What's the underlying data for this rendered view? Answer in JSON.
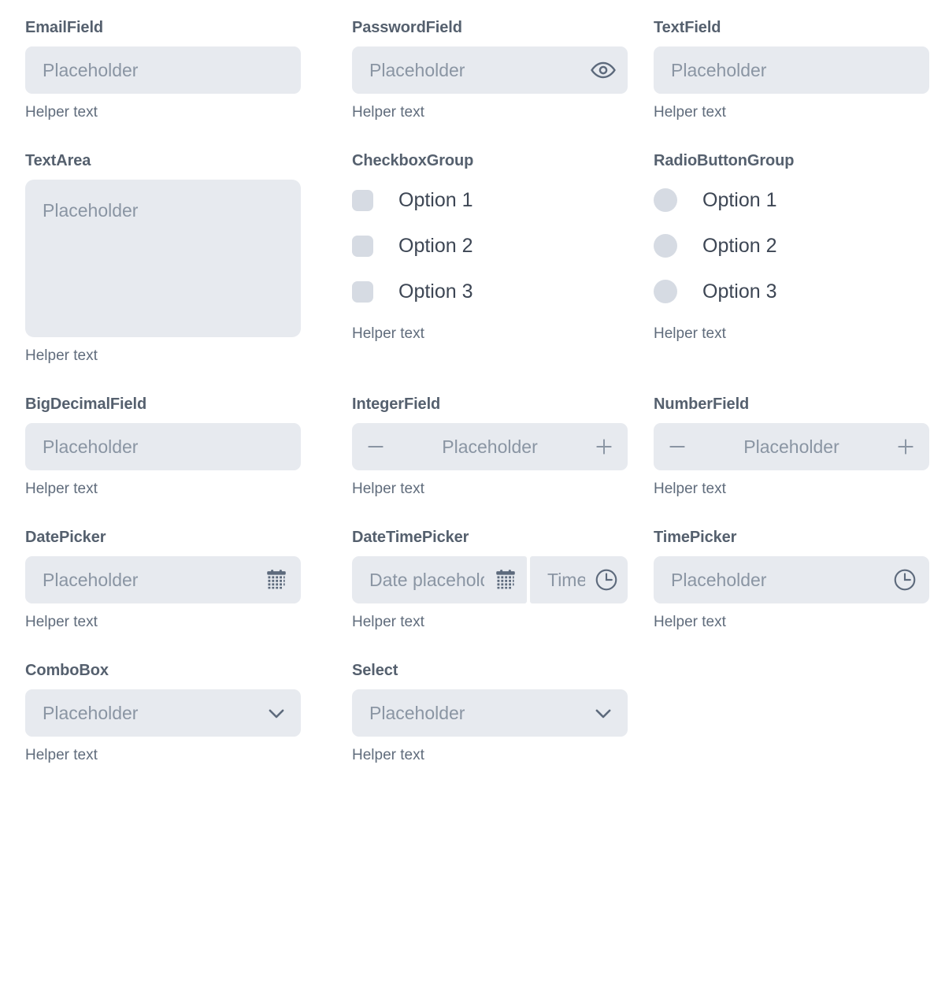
{
  "common": {
    "placeholder": "Placeholder",
    "helper_text": "Helper text",
    "date_placeholder": "Date placeholder",
    "time_placeholder": "Time placeholder"
  },
  "colors": {
    "page_background": "#ffffff",
    "field_background": "#e7eaef",
    "label_text": "#55606e",
    "placeholder_text": "#8a95a3",
    "helper_text": "#606c7c",
    "option_box": "#d6dbe3",
    "option_label": "#3d4654",
    "icon": "#5d6a7c"
  },
  "components": {
    "email_field": {
      "label": "EmailField",
      "placeholder": "Placeholder",
      "helper": "Helper text"
    },
    "password_field": {
      "label": "PasswordField",
      "placeholder": "Placeholder",
      "helper": "Helper text",
      "icon": "eye-icon"
    },
    "text_field": {
      "label": "TextField",
      "placeholder": "Placeholder",
      "helper": "Helper text"
    },
    "text_area": {
      "label": "TextArea",
      "placeholder": "Placeholder",
      "helper": "Helper text"
    },
    "checkbox_group": {
      "label": "CheckboxGroup",
      "helper": "Helper text",
      "options": [
        {
          "label": "Option 1",
          "checked": false
        },
        {
          "label": "Option 2",
          "checked": false
        },
        {
          "label": "Option 3",
          "checked": false
        }
      ]
    },
    "radio_button_group": {
      "label": "RadioButtonGroup",
      "helper": "Helper text",
      "options": [
        {
          "label": "Option 1",
          "selected": false
        },
        {
          "label": "Option 2",
          "selected": false
        },
        {
          "label": "Option 3",
          "selected": false
        }
      ]
    },
    "big_decimal_field": {
      "label": "BigDecimalField",
      "placeholder": "Placeholder",
      "helper": "Helper text"
    },
    "integer_field": {
      "label": "IntegerField",
      "placeholder": "Placeholder",
      "helper": "Helper text",
      "decrement_icon": "minus-icon",
      "increment_icon": "plus-icon"
    },
    "number_field": {
      "label": "NumberField",
      "placeholder": "Placeholder",
      "helper": "Helper text",
      "decrement_icon": "minus-icon",
      "increment_icon": "plus-icon"
    },
    "date_picker": {
      "label": "DatePicker",
      "placeholder": "Placeholder",
      "helper": "Helper text",
      "icon": "calendar-icon"
    },
    "date_time_picker": {
      "label": "DateTimePicker",
      "date_placeholder": "Date placeholder",
      "time_placeholder": "Time placeholder",
      "helper": "Helper text",
      "date_icon": "calendar-icon",
      "time_icon": "clock-icon"
    },
    "time_picker": {
      "label": "TimePicker",
      "placeholder": "Placeholder",
      "helper": "Helper text",
      "icon": "clock-icon"
    },
    "combo_box": {
      "label": "ComboBox",
      "placeholder": "Placeholder",
      "helper": "Helper text",
      "icon": "chevron-down-icon"
    },
    "select": {
      "label": "Select",
      "placeholder": "Placeholder",
      "helper": "Helper text",
      "icon": "chevron-down-icon"
    }
  }
}
